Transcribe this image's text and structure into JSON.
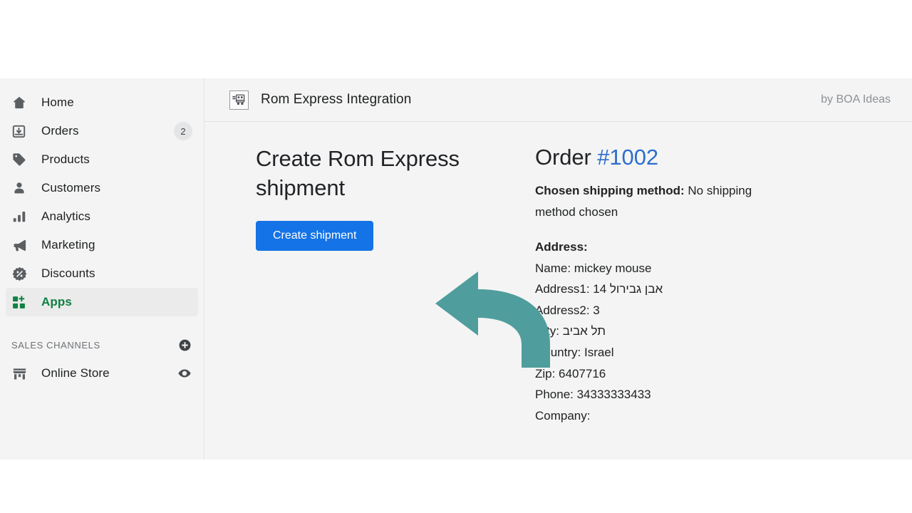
{
  "sidebar": {
    "items": [
      {
        "label": "Home",
        "icon": "home-icon",
        "badge": null,
        "active": false
      },
      {
        "label": "Orders",
        "icon": "orders-inbox-icon",
        "badge": "2",
        "active": false
      },
      {
        "label": "Products",
        "icon": "tag-icon",
        "badge": null,
        "active": false
      },
      {
        "label": "Customers",
        "icon": "person-icon",
        "badge": null,
        "active": false
      },
      {
        "label": "Analytics",
        "icon": "bar-chart-icon",
        "badge": null,
        "active": false
      },
      {
        "label": "Marketing",
        "icon": "megaphone-icon",
        "badge": null,
        "active": false
      },
      {
        "label": "Discounts",
        "icon": "discount-percent-icon",
        "badge": null,
        "active": false
      },
      {
        "label": "Apps",
        "icon": "apps-grid-plus-icon",
        "badge": null,
        "active": true
      }
    ],
    "sales_channels": {
      "title": "SALES CHANNELS",
      "add_icon": "plus-circle-icon",
      "items": [
        {
          "label": "Online Store",
          "icon": "storefront-icon",
          "action_icon": "eye-icon"
        }
      ]
    }
  },
  "header": {
    "app_icon": "delivery-truck-icon",
    "title": "Rom Express Integration",
    "author": "by BOA Ideas"
  },
  "main": {
    "create_panel": {
      "title": "Create Rom Express shipment",
      "button_label": "Create shipment"
    },
    "order_panel": {
      "title_prefix": "Order",
      "order_number": "#1002",
      "shipping_label": "Chosen shipping method:",
      "shipping_value": "No shipping method chosen",
      "address_heading": "Address:",
      "address_lines": [
        "Name: mickey mouse",
        "Address1: 14 אבן גבירול",
        "Address2: 3",
        "City: תל אביב",
        "Country: Israel",
        "Zip: 6407716",
        "Phone: 34333333433",
        "Company:"
      ]
    }
  },
  "annotation": {
    "type": "curved-arrow-left",
    "color": "#4f9e9d"
  },
  "colors": {
    "accent_blue": "#1473e6",
    "link_blue": "#2c6ecb",
    "active_green": "#108043",
    "annotation_teal": "#4f9e9d",
    "page_bg": "#f4f4f4"
  }
}
